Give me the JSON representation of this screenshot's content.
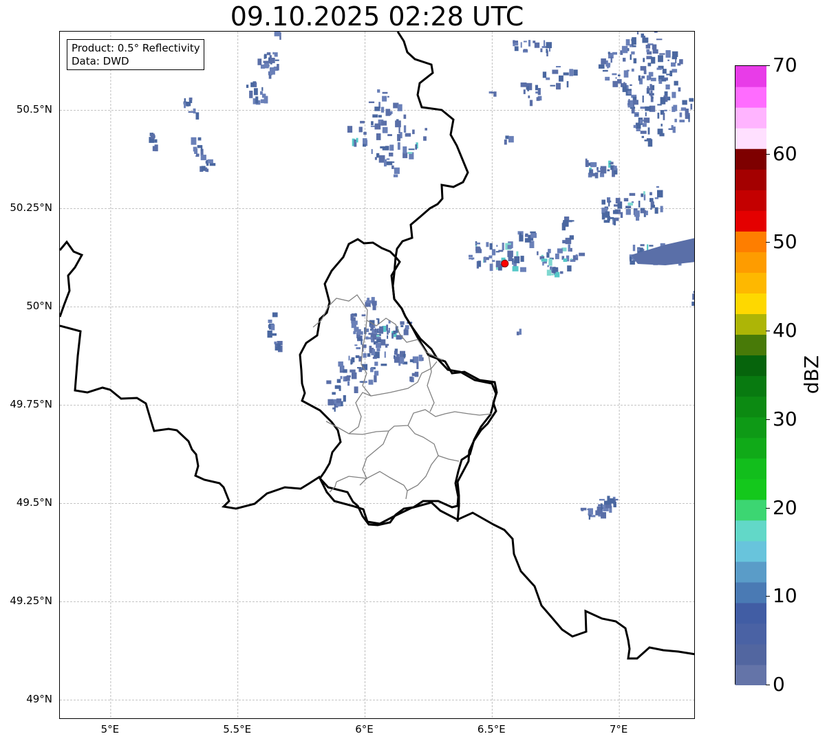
{
  "title": "09.10.2025 02:28 UTC",
  "info_box": {
    "product": "Product: 0.5° Reflectivity",
    "source": "Data: DWD"
  },
  "map": {
    "lon_range": [
      4.8,
      7.3
    ],
    "lat_range": [
      48.95,
      50.7
    ],
    "lat_ticks": [
      {
        "value": 50.5,
        "label": "50.5°N"
      },
      {
        "value": 50.25,
        "label": "50.25°N"
      },
      {
        "value": 50.0,
        "label": "50°N"
      },
      {
        "value": 49.75,
        "label": "49.75°N"
      },
      {
        "value": 49.5,
        "label": "49.5°N"
      },
      {
        "value": 49.25,
        "label": "49.25°N"
      },
      {
        "value": 49.0,
        "label": "49°N"
      }
    ],
    "lon_ticks": [
      {
        "value": 5.0,
        "label": "5°E"
      },
      {
        "value": 5.5,
        "label": "5.5°E"
      },
      {
        "value": 6.0,
        "label": "6°E"
      },
      {
        "value": 6.5,
        "label": "6.5°E"
      },
      {
        "value": 7.0,
        "label": "7°E"
      }
    ],
    "gridlines": "dashed",
    "radar_site": {
      "lon": 6.55,
      "lat": 50.11,
      "color": "#ff0000"
    },
    "echo_colors": [
      "#5a6fa8",
      "#4a67a0",
      "#6a80b8",
      "#56c8c8",
      "#7fd8d0"
    ]
  },
  "colorbar": {
    "label": "dBZ",
    "min": 0,
    "max": 70,
    "tick_labels": [
      "0",
      "10",
      "20",
      "30",
      "40",
      "50",
      "60",
      "70"
    ],
    "colors": [
      "#6474a8",
      "#5266a0",
      "#4a62a4",
      "#415da4",
      "#4a7ab4",
      "#5a9cc8",
      "#68c4dc",
      "#62d8c8",
      "#3cd672",
      "#14c81c",
      "#12be1c",
      "#10aa18",
      "#0e9a16",
      "#0c8a12",
      "#087a10",
      "#06640c",
      "#487a08",
      "#adb506",
      "#fed800",
      "#feb800",
      "#fe9c00",
      "#fe7e00",
      "#e40000",
      "#c40000",
      "#a40000",
      "#7e0000",
      "#ffe0ff",
      "#ffb4ff",
      "#ff6cff",
      "#e83ce8"
    ]
  }
}
